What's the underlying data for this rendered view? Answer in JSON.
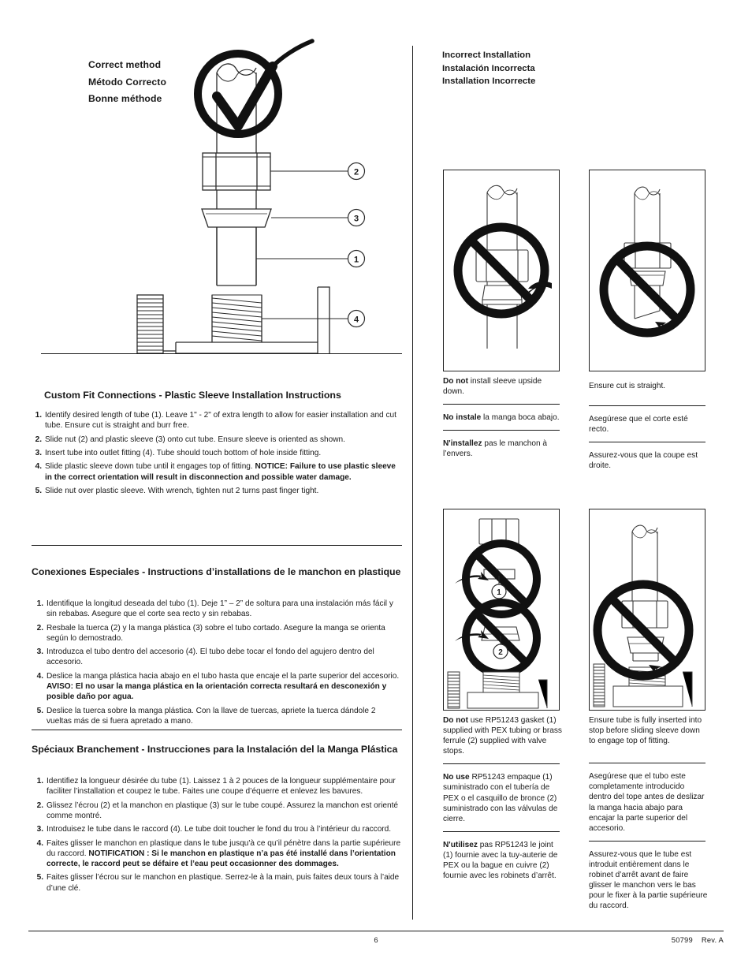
{
  "left_column": {
    "correct_heading": [
      "Correct method",
      "Método Correcto",
      "Bonne méthode"
    ],
    "illustration": {
      "name": "correct-method-assembly-diagram",
      "callouts": [
        "2",
        "3",
        "1",
        "4"
      ],
      "check_icon": "checkmark-in-circle-icon"
    },
    "sections": [
      {
        "title": "Custom Fit Connections - Plastic Sleeve Installation Instructions",
        "steps": [
          {
            "num": "1.",
            "runs": [
              {
                "text": "Identify desired length of tube (1). Leave 1\" - 2\" of extra length to allow for easier installation and cut tube. Ensure cut is straight and burr free.",
                "bold": false
              }
            ]
          },
          {
            "num": "2.",
            "runs": [
              {
                "text": "Slide nut (2) and plastic sleeve (3) onto cut tube. Ensure sleeve is oriented as shown.",
                "bold": false
              }
            ]
          },
          {
            "num": "3.",
            "runs": [
              {
                "text": "Insert tube into outlet fitting (4). Tube should touch bottom of hole inside fitting.",
                "bold": false
              }
            ]
          },
          {
            "num": "4.",
            "runs": [
              {
                "text": "Slide plastic sleeve down tube until it engages top of fitting. ",
                "bold": false
              },
              {
                "text": "NOTICE: Failure to use plastic sleeve in the correct orientation will result in disconnection and possible water damage.",
                "bold": true
              }
            ]
          },
          {
            "num": "5.",
            "runs": [
              {
                "text": "Slide nut over plastic sleeve. With wrench, tighten nut 2 turns past finger tight.",
                "bold": false
              }
            ]
          }
        ]
      },
      {
        "title": "Conexiones Especiales - Instructions d’installations de le manchon en plastique",
        "steps": [
          {
            "num": "1.",
            "runs": [
              {
                "text": "Identifique la longitud deseada del tubo (1). Deje 1” – 2” de soltura para una instalación más fácil y sin rebabas. Asegure que el corte sea recto y sin rebabas.",
                "bold": false
              }
            ]
          },
          {
            "num": "2.",
            "runs": [
              {
                "text": "Resbale la tuerca (2) y la manga plástica (3) sobre el tubo cortado. Asegure la manga se orienta según lo demostrado.",
                "bold": false
              }
            ]
          },
          {
            "num": "3.",
            "runs": [
              {
                "text": "Introduzca el tubo dentro del accesorio (4). El tubo debe tocar el fondo del agujero dentro del accesorio.",
                "bold": false
              }
            ]
          },
          {
            "num": "4.",
            "runs": [
              {
                "text": "Deslice la manga plástica hacia abajo en el tubo hasta que encaje el la parte superior del accesorio. ",
                "bold": false
              },
              {
                "text": "AVISO: El no usar la manga plástica en la orientación correcta resultará en desconexión y posible daño por agua.",
                "bold": true
              }
            ]
          },
          {
            "num": "5.",
            "runs": [
              {
                "text": "Deslice la tuerca sobre la manga plástica. Con la llave de tuercas, apriete la tuerca dándole 2 vueltas más de si fuera apretado a mano.",
                "bold": false
              }
            ]
          }
        ]
      },
      {
        "title": "Spéciaux Branchement - Instrucciones para la Instalación del la Manga Plástica",
        "steps": [
          {
            "num": "1.",
            "runs": [
              {
                "text": "Identifiez la longueur désirée du tube (1). Laissez 1 à 2 pouces de la longueur supplémentaire pour faciliter l’installation et coupez le tube. Faites une coupe d’équerre et enlevez les bavures.",
                "bold": false
              }
            ]
          },
          {
            "num": "2.",
            "runs": [
              {
                "text": "Glissez l’écrou (2) et la manchon en plastique (3) sur le tube coupé. Assurez la manchon est orienté comme montré.",
                "bold": false
              }
            ]
          },
          {
            "num": "3.",
            "runs": [
              {
                "text": "Introduisez le tube dans le raccord (4). Le tube doit toucher le fond du trou à l’intérieur du raccord.",
                "bold": false
              }
            ]
          },
          {
            "num": "4.",
            "runs": [
              {
                "text": "Faites glisser le manchon en plastique dans le tube jusqu'à ce qu’il pénètre dans la partie supérieure du raccord. ",
                "bold": false
              },
              {
                "text": "NOTIFICATION : Si le manchon en plastique n’a pas été installé dans l’orientation correcte, le raccord peut se défaire et l’eau peut occasionner des dommages.",
                "bold": true
              }
            ]
          },
          {
            "num": "5.",
            "runs": [
              {
                "text": "Faites glisser l’écrou sur le manchon en plastique. Serrez-le à la main, puis faites deux tours à l’aide d’une clé.",
                "bold": false
              }
            ]
          }
        ]
      }
    ]
  },
  "right_column": {
    "incorrect_heading": [
      "Incorrect Installation",
      "Instalación Incorrecta",
      "Installation Incorrecte"
    ],
    "figures": [
      {
        "name": "figure-sleeve-upside-down",
        "icon": "prohibition-circle-icon",
        "captions": [
          {
            "runs": [
              {
                "text": "Do not",
                "bold": true
              },
              {
                "text": " install sleeve upside down.",
                "bold": false
              }
            ]
          },
          {
            "runs": [
              {
                "text": "No instale",
                "bold": true
              },
              {
                "text": " la manga boca abajo.",
                "bold": false
              }
            ]
          },
          {
            "runs": [
              {
                "text": "N'installez",
                "bold": true
              },
              {
                "text": " pas le manchon à l’envers.",
                "bold": false
              }
            ]
          }
        ]
      },
      {
        "name": "figure-angled-cut",
        "icon": "prohibition-circle-icon",
        "captions": [
          {
            "runs": [
              {
                "text": "Ensure cut is straight.",
                "bold": false
              }
            ]
          },
          {
            "runs": [
              {
                "text": "Asegúrese que el corte esté recto.",
                "bold": false
              }
            ]
          },
          {
            "runs": [
              {
                "text": "Assurez-vous que la coupe est droite.",
                "bold": false
              }
            ]
          }
        ]
      },
      {
        "name": "figure-no-gasket-or-ferrule",
        "icon": "prohibition-circle-icon",
        "callouts": [
          "1",
          "2"
        ],
        "captions": [
          {
            "runs": [
              {
                "text": "Do not",
                "bold": true
              },
              {
                "text": " use RP51243 gasket (1) supplied with PEX tubing or brass ferrule (2) supplied with valve stops.",
                "bold": false
              }
            ]
          },
          {
            "runs": [
              {
                "text": "No use",
                "bold": true
              },
              {
                "text": " RP51243 empaque (1) suministrado con el tubería de PEX o el casquillo de bronce (2) suministrado con las válvulas de cierre.",
                "bold": false
              }
            ]
          },
          {
            "runs": [
              {
                "text": "N'utilisez",
                "bold": true
              },
              {
                "text": " pas RP51243 le joint (1) fournie avec la tuy-auterie de PEX ou la bague en cuivre (2) fournie avec les robinets d’arrêt.",
                "bold": false
              }
            ]
          }
        ]
      },
      {
        "name": "figure-tube-not-fully-inserted",
        "icon": "prohibition-circle-icon",
        "captions": [
          {
            "runs": [
              {
                "text": "Ensure tube is fully inserted into stop before sliding sleeve down to engage top of fitting.",
                "bold": false
              }
            ]
          },
          {
            "runs": [
              {
                "text": "Asegúrese que el tubo este completamente introducido dentro del tope antes de deslizar la manga hacia abajo para encajar la parte superior del accesorio.",
                "bold": false
              }
            ]
          },
          {
            "runs": [
              {
                "text": "Assurez-vous que le tube est introduit entièrement dans le robinet d’arrêt avant de faire glisser le manchon vers le bas pour le fixer à la partie supérieure du raccord.",
                "bold": false
              }
            ]
          }
        ]
      }
    ]
  },
  "footer": {
    "page_number": "6",
    "doc_code": "50799",
    "revision": "Rev. A"
  }
}
